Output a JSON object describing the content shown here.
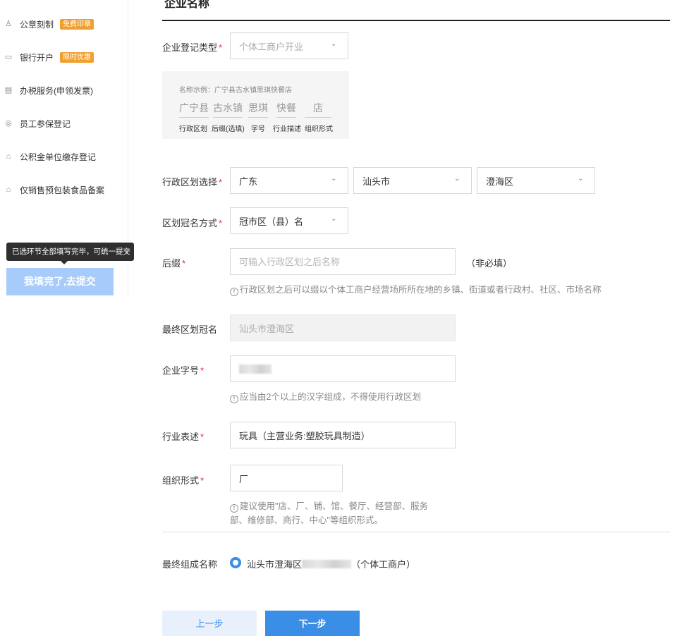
{
  "sidebar": {
    "items": [
      {
        "icon": "stamp-icon",
        "glyph": "♙",
        "label": "公章刻制",
        "badge": "免费印章"
      },
      {
        "icon": "bank-card-icon",
        "glyph": "▭",
        "label": "银行开户",
        "badge": "限时优惠"
      },
      {
        "icon": "invoice-icon",
        "glyph": "▤",
        "label": "办税服务(申领发票)",
        "badge": ""
      },
      {
        "icon": "shield-icon",
        "glyph": "◎",
        "label": "员工参保登记",
        "badge": ""
      },
      {
        "icon": "house-icon",
        "glyph": "⌂",
        "label": "公积金单位缴存登记",
        "badge": ""
      },
      {
        "icon": "house-icon",
        "glyph": "⌂",
        "label": "仅销售预包装食品备案",
        "badge": ""
      }
    ],
    "tooltip": "已选环节全部填写完毕，可统一提交",
    "tooltip_close": "×",
    "done_button": "我填完了,去提交"
  },
  "main": {
    "title": "企业名称",
    "reg_type": {
      "label": "企业登记类型",
      "value": "个体工商户开业"
    },
    "example": {
      "caption": "名称示例：广宁县古水镇思琪快餐店",
      "parts": [
        "广宁县",
        "古水镇",
        "思琪",
        "快餐",
        "店"
      ],
      "captions": [
        "行政区划",
        "后缀(选填)",
        "字号",
        "行业描述",
        "组织形式"
      ]
    },
    "region": {
      "label": "行政区划选择",
      "province": "广东",
      "city": "汕头市",
      "district": "澄海区"
    },
    "naming_method": {
      "label": "区划冠名方式",
      "value": "冠市区（县）名"
    },
    "suffix": {
      "label": "后缀",
      "placeholder": "可输入行政区划之后名称",
      "note": "（非必填）",
      "hint": "行政区划之后可以缀以个体工商户经营场所所在地的乡镇、街道或者行政村、社区、市场名称"
    },
    "final_region": {
      "label": "最终区划冠名",
      "value": "汕头市澄海区"
    },
    "trade_name": {
      "label": "企业字号",
      "hint": "应当由2个以上的汉字组成，不得使用行政区划"
    },
    "industry": {
      "label": "行业表述",
      "value": "玩具（主营业务:塑胶玩具制造）"
    },
    "org_form": {
      "label": "组织形式",
      "value": "厂",
      "hint_line1": "建议使用\"店、厂、铺、馆、餐厅、经营部、服务",
      "hint_line2": "部、维修部、商行、中心\"等组织形式。"
    },
    "final_name": {
      "label": "最终组成名称",
      "prefix": "汕头市澄海区",
      "suffix": "（个体工商户）"
    },
    "buttons": {
      "prev": "上一步",
      "next": "下一步"
    },
    "required_mark": "*",
    "hint_glyph": "!",
    "chevron": "⌄"
  }
}
